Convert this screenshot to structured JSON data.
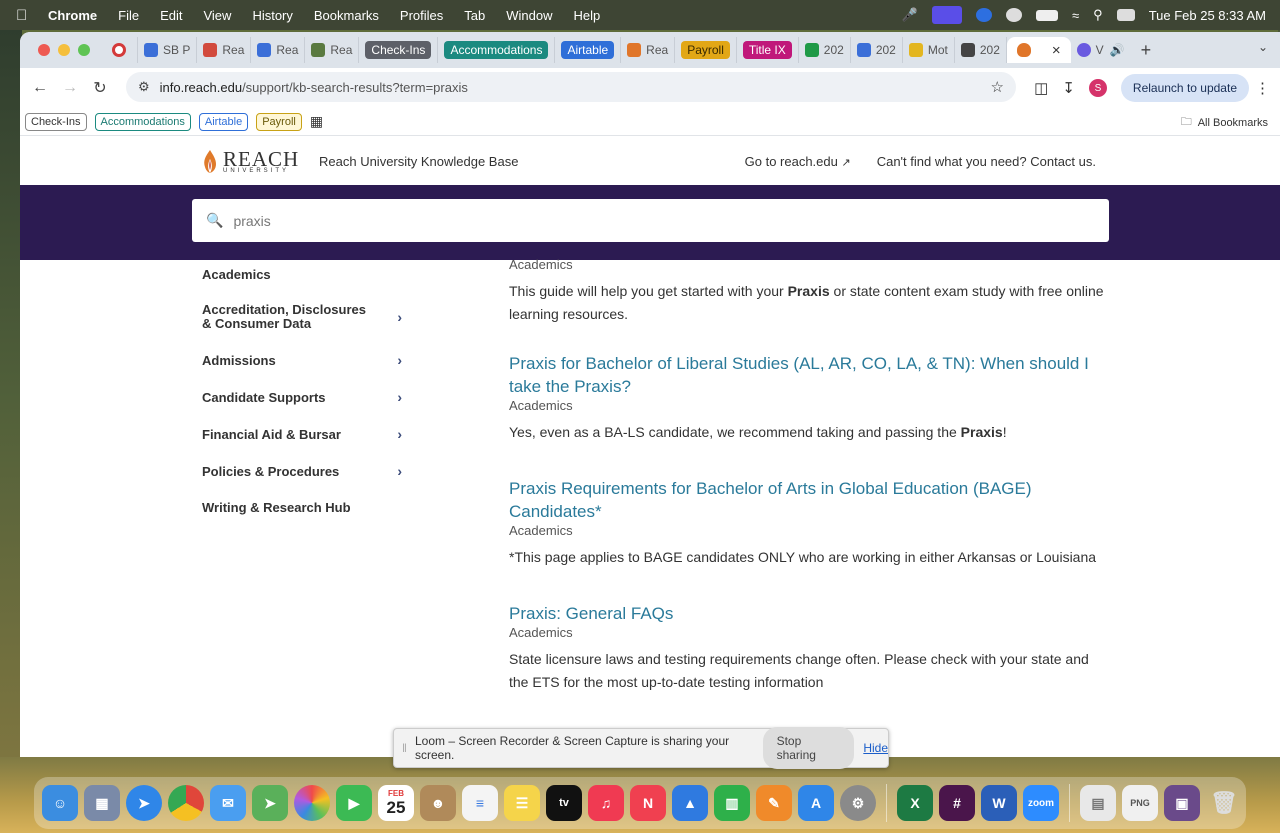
{
  "menubar": {
    "app": "Chrome",
    "items": [
      "File",
      "Edit",
      "View",
      "History",
      "Bookmarks",
      "Profiles",
      "Tab",
      "Window",
      "Help"
    ],
    "clock": "Tue Feb 25  8:33 AM"
  },
  "tabs": [
    {
      "label": "SB P",
      "color": "#3b6fd8"
    },
    {
      "label": "Rea",
      "color": "#d24a3d"
    },
    {
      "label": "Rea",
      "color": "#3b6fd8"
    },
    {
      "label": "Rea",
      "color": "#5a7a40"
    },
    {
      "label": "Check-Ins",
      "pill": "#5d6068"
    },
    {
      "label": "Accommodations",
      "pill": "#1b8a80"
    },
    {
      "label": "Airtable",
      "pill": "#2f6fd8"
    },
    {
      "label": "Rea",
      "color": "#e0762a"
    },
    {
      "label": "Payroll",
      "pill": "#e2a716"
    },
    {
      "label": "Title IX",
      "pill": "#c0187a"
    },
    {
      "label": "202",
      "color": "#1f9a47"
    },
    {
      "label": "202",
      "color": "#3b6fd8"
    },
    {
      "label": "Mot",
      "color": "#e3b620"
    },
    {
      "label": "202",
      "color": "#444444"
    }
  ],
  "active_tab": {
    "label": "",
    "close": "×"
  },
  "last_tab": {
    "label": "V"
  },
  "address": {
    "host": "info.reach.edu",
    "path": "/support/kb-search-results?term=praxis"
  },
  "relaunch_label": "Relaunch to update",
  "avatar_letter": "S",
  "bookmarks": [
    "Check-Ins",
    "Accommodations",
    "Airtable",
    "Payroll"
  ],
  "all_bookmarks": "All Bookmarks",
  "site": {
    "logo_word": "REACH",
    "logo_sub": "UNIVERSITY",
    "kb_title": "Reach University Knowledge Base",
    "go_link": "Go to reach.edu",
    "contact_link": "Can't find what you need? Contact us.",
    "search_value": "praxis"
  },
  "sidebar": [
    {
      "label": "Academics",
      "chevron": false
    },
    {
      "label": "Accreditation, Disclosures & Consumer Data",
      "chevron": true
    },
    {
      "label": "Admissions",
      "chevron": true
    },
    {
      "label": "Candidate Supports",
      "chevron": true
    },
    {
      "label": "Financial Aid & Bursar",
      "chevron": true
    },
    {
      "label": "Policies & Procedures",
      "chevron": true
    },
    {
      "label": "Writing & Research Hub",
      "chevron": false
    }
  ],
  "results": {
    "top_partial": {
      "category": "Academics",
      "snippet_pre": "This guide will help you get started with your ",
      "snippet_bold": "Praxis",
      "snippet_post": " or state content exam study with free online learning resources."
    },
    "items": [
      {
        "title": "Praxis for Bachelor of Liberal Studies (AL, AR, CO, LA, & TN): When should I take the Praxis?",
        "category": "Academics",
        "snippet_pre": "Yes, even as a BA-LS candidate, we recommend taking and passing the ",
        "snippet_bold": "Praxis",
        "snippet_post": "!"
      },
      {
        "title": "Praxis Requirements for Bachelor of Arts in Global Education (BAGE) Candidates*",
        "category": "Academics",
        "snippet_pre": "*This page applies to BAGE candidates ONLY who are working in either Arkansas or Louisiana",
        "snippet_bold": "",
        "snippet_post": ""
      },
      {
        "title": "Praxis: General FAQs",
        "category": "Academics",
        "snippet_pre": "State licensure laws and testing requirements change often. Please check with your state and the ETS for the most up-to-date testing information",
        "snippet_bold": "",
        "snippet_post": ""
      }
    ]
  },
  "loom": {
    "message": "Loom – Screen Recorder & Screen Capture is sharing your screen.",
    "stop": "Stop sharing",
    "hide": "Hide"
  },
  "dock": {
    "calendar_month": "FEB",
    "calendar_day": "25",
    "apps": [
      {
        "name": "finder",
        "color": "#3b8de0"
      },
      {
        "name": "launchpad",
        "color": "#7a8aa8"
      },
      {
        "name": "safari",
        "color": "#2f86e8"
      },
      {
        "name": "chrome",
        "color": "#e0463a"
      },
      {
        "name": "mail",
        "color": "#4a9ef0"
      },
      {
        "name": "maps",
        "color": "#5ab05a"
      },
      {
        "name": "photos",
        "color": "#e8a23a"
      },
      {
        "name": "facetime",
        "color": "#3cba54"
      },
      {
        "name": "calendar",
        "color": "#ffffff"
      },
      {
        "name": "contacts",
        "color": "#b08a5a"
      },
      {
        "name": "reminders",
        "color": "#f4f4f4"
      },
      {
        "name": "notes",
        "color": "#f5d44a"
      },
      {
        "name": "tv",
        "color": "#111111"
      },
      {
        "name": "music",
        "color": "#f03a52"
      },
      {
        "name": "news",
        "color": "#f04050"
      },
      {
        "name": "keynote",
        "color": "#2f7ae0"
      },
      {
        "name": "numbers",
        "color": "#2eb04a"
      },
      {
        "name": "pages",
        "color": "#f08a2a"
      },
      {
        "name": "app-store",
        "color": "#2f86e8"
      },
      {
        "name": "system-settings",
        "color": "#8a8a8a"
      },
      {
        "name": "excel",
        "color": "#1d7a43"
      },
      {
        "name": "slack",
        "color": "#4a154b"
      },
      {
        "name": "word",
        "color": "#2b5fb8"
      },
      {
        "name": "zoom",
        "color": "#2d8cff"
      }
    ]
  }
}
